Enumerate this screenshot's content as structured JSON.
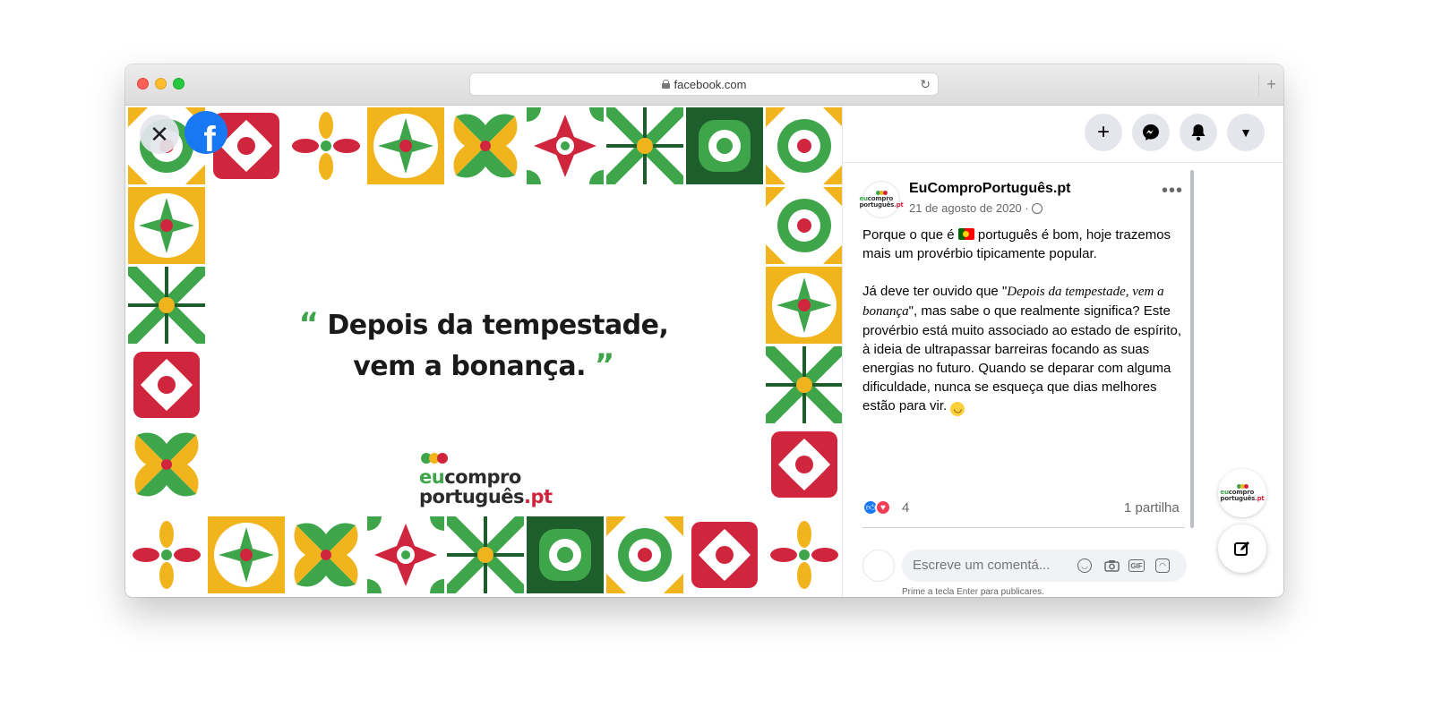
{
  "browser": {
    "url": "facebook.com",
    "reload_icon": "reload-icon",
    "new_tab": "+"
  },
  "viewer": {
    "close_label": "✕",
    "fb_letter": "f",
    "quote_open": "“",
    "quote_text_line1": "Depois da tempestade,",
    "quote_text_line2": "vem a bonança.",
    "quote_close": "”",
    "brand": {
      "part1": "eu",
      "part2": "compro",
      "part3": "português",
      "part4": ".pt"
    },
    "colors": {
      "green": "#3ea54a",
      "dark_green": "#1e5e2c",
      "red": "#d0263d",
      "yellow": "#f2b41c",
      "cream": "#fff8e8"
    }
  },
  "topbar": {
    "create_label": "+",
    "messenger_icon": "messenger-icon",
    "notifications_icon": "bell-icon",
    "account_label": "▼"
  },
  "post": {
    "page_name": "EuComproPortuguês.pt",
    "date": "21 de agosto de 2020 ·",
    "more_label": "•••",
    "text_p1_a": "Porque o que é ",
    "text_p1_b": " português é bom, hoje trazemos mais um provérbio tipicamente popular.",
    "text_p2_a": "Já deve ter ouvido que \"",
    "text_p2_em": "Depois da tempestade, vem a bonança",
    "text_p2_b": "\", mas sabe o que realmente significa? Este provérbio está muito associado ao estado de espírito, à ideia de ultrapassar barreiras focando as suas energias no futuro. Quando se deparar com alguma dificuldade, nunca se esqueça que dias melhores estão para vir. ",
    "reaction_count": "4",
    "shares": "1 partilha",
    "comment_placeholder": "Escreve um comentá...",
    "gif_label": "GIF",
    "hint": "Prime a tecla Enter para publicares."
  }
}
